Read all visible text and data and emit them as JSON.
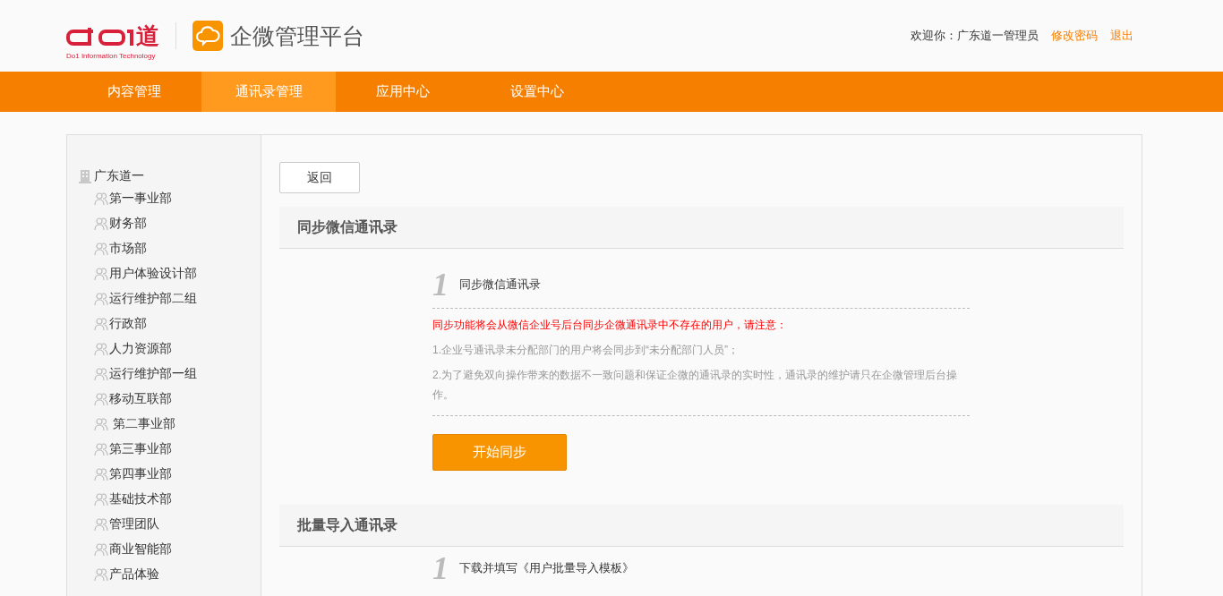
{
  "header": {
    "logo_text": "道",
    "logo_subtitle": "Do1 Information Technology",
    "platform_title": "企微管理平台",
    "welcome": "欢迎你：广东道一管理员",
    "links": [
      "修改密码",
      "退出"
    ]
  },
  "nav": [
    {
      "label": "内容管理",
      "selected": false
    },
    {
      "label": "通讯录管理",
      "selected": true
    },
    {
      "label": "应用中心",
      "selected": false
    },
    {
      "label": "设置中心",
      "selected": false
    }
  ],
  "tree": {
    "label": "广东道一",
    "children": [
      {
        "label": "第一事业部"
      },
      {
        "label": "财务部"
      },
      {
        "label": "市场部"
      },
      {
        "label": "用户体验设计部"
      },
      {
        "label": "运行维护部二组"
      },
      {
        "label": "行政部"
      },
      {
        "label": "人力资源部"
      },
      {
        "label": "运行维护部一组"
      },
      {
        "label": "移动互联部"
      },
      {
        "label": " 第二事业部"
      },
      {
        "label": "第三事业部"
      },
      {
        "label": "第四事业部"
      },
      {
        "label": "基础技术部"
      },
      {
        "label": "管理团队"
      },
      {
        "label": "商业智能部"
      },
      {
        "label": "产品体验"
      }
    ]
  },
  "back_button": "返回",
  "sections": [
    {
      "title": "同步微信通讯录",
      "step_number": "1",
      "step_title": "同步微信通讯录",
      "warning": "同步功能将会从微信企业号后台同步企微通讯录中不存在的用户，请注意：",
      "notes": [
        "1.企业号通讯录未分配部门的用户将会同步到“未分配部门人员”；",
        "2.为了避免双向操作带来的数据不一致问题和保证企微的通讯录的实时性，通讯录的维护请只在企微管理后台操作。"
      ],
      "button": "开始同步"
    },
    {
      "title": "批量导入通讯录",
      "step_number": "1",
      "step_title": "下载并填写《用户批量导入模板》"
    }
  ]
}
